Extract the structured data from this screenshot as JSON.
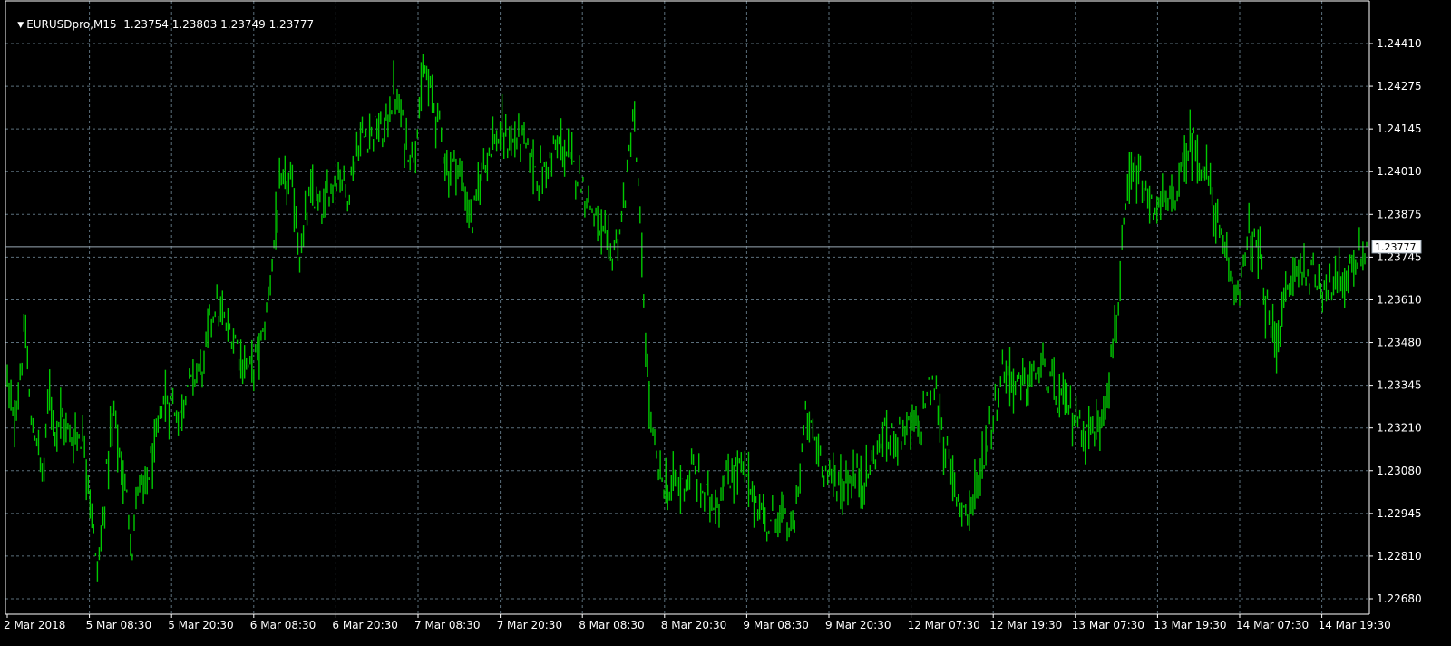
{
  "chart_header": {
    "menu_arrow": "▼",
    "symbol": "EURUSDpro,M15",
    "ohlc": "1.23754 1.23803 1.23749 1.23777"
  },
  "current_price": "1.23777",
  "colors": {
    "background": "#000000",
    "grid": "#5b6f7c",
    "bars": "#00c800",
    "axis": "#ffffff",
    "price_line": "#9aa9b5"
  },
  "chart_data": {
    "type": "line",
    "instrument": "EURUSDpro",
    "timeframe": "M15",
    "grid": true,
    "y_ticks": [
      "1.24410",
      "1.24275",
      "1.24145",
      "1.24010",
      "1.23875",
      "1.23745",
      "1.23610",
      "1.23480",
      "1.23345",
      "1.23210",
      "1.23080",
      "1.22945",
      "1.22810",
      "1.22680"
    ],
    "x_ticks": [
      "2 Mar 2018",
      "5 Mar 08:30",
      "5 Mar 20:30",
      "6 Mar 08:30",
      "6 Mar 20:30",
      "7 Mar 08:30",
      "7 Mar 20:30",
      "8 Mar 08:30",
      "8 Mar 20:30",
      "9 Mar 08:30",
      "9 Mar 20:30",
      "12 Mar 07:30",
      "12 Mar 19:30",
      "13 Mar 07:30",
      "13 Mar 19:30",
      "14 Mar 07:30",
      "14 Mar 19:30"
    ],
    "ylim": [
      1.2268,
      1.2441
    ],
    "last_price": 1.23777,
    "series": [
      {
        "values": [
          1.2337,
          1.2322,
          1.2335,
          1.2352,
          1.2322,
          1.2318,
          1.2305,
          1.2334,
          1.2322,
          1.2325,
          1.232,
          1.2318,
          1.232,
          1.2316,
          1.23,
          1.2275,
          1.229,
          1.2315,
          1.2326,
          1.231,
          1.23,
          1.2284,
          1.2305,
          1.23,
          1.231,
          1.2315,
          1.233,
          1.233,
          1.2328,
          1.2325,
          1.2335,
          1.2335,
          1.234,
          1.234,
          1.2355,
          1.236,
          1.2355,
          1.2352,
          1.235,
          1.2345,
          1.234,
          1.234,
          1.2345,
          1.235,
          1.2365,
          1.2385,
          1.2395,
          1.2398,
          1.2395,
          1.2375,
          1.2385,
          1.2395,
          1.239,
          1.2388,
          1.2395,
          1.24,
          1.24,
          1.2395,
          1.2402,
          1.241,
          1.2412,
          1.2413,
          1.2415,
          1.2412,
          1.242,
          1.2425,
          1.2418,
          1.241,
          1.2405,
          1.242,
          1.2432,
          1.2425,
          1.242,
          1.241,
          1.24,
          1.2405,
          1.24,
          1.2392,
          1.2385,
          1.2395,
          1.2405,
          1.241,
          1.241,
          1.2412,
          1.241,
          1.241,
          1.2412,
          1.2408,
          1.2405,
          1.24,
          1.24,
          1.2405,
          1.2408,
          1.241,
          1.2405,
          1.2402,
          1.24,
          1.2395,
          1.239,
          1.2385,
          1.238,
          1.2375,
          1.2378,
          1.2385,
          1.24,
          1.242,
          1.239,
          1.235,
          1.232,
          1.231,
          1.2305,
          1.23,
          1.2305,
          1.2303,
          1.2305,
          1.2308,
          1.2305,
          1.23,
          1.23,
          1.2298,
          1.2303,
          1.2305,
          1.2308,
          1.231,
          1.2305,
          1.23,
          1.2298,
          1.2292,
          1.229,
          1.2295,
          1.2293,
          1.229,
          1.229,
          1.231,
          1.2325,
          1.232,
          1.2315,
          1.231,
          1.2305,
          1.2305,
          1.2303,
          1.2305,
          1.2306,
          1.2306,
          1.2305,
          1.231,
          1.2315,
          1.2318,
          1.2318,
          1.232,
          1.232,
          1.2322,
          1.2322,
          1.232,
          1.233,
          1.2335,
          1.233,
          1.2318,
          1.231,
          1.2302,
          1.2298,
          1.2295,
          1.23,
          1.2305,
          1.2315,
          1.2322,
          1.233,
          1.234,
          1.2338,
          1.2335,
          1.2335,
          1.2335,
          1.2337,
          1.234,
          1.2338,
          1.2335,
          1.233,
          1.233,
          1.2328,
          1.2325,
          1.2322,
          1.232,
          1.232,
          1.2322,
          1.233,
          1.234,
          1.2355,
          1.2375,
          1.2395,
          1.24,
          1.2398,
          1.2392,
          1.239,
          1.239,
          1.2392,
          1.239,
          1.2395,
          1.24,
          1.2408,
          1.241,
          1.2405,
          1.24,
          1.2395,
          1.2385,
          1.2375,
          1.2368,
          1.2365,
          1.2368,
          1.2378,
          1.238,
          1.2375,
          1.236,
          1.2352,
          1.235,
          1.2358,
          1.2365,
          1.237,
          1.2372,
          1.237,
          1.2368,
          1.2368,
          1.2366,
          1.2366,
          1.2366,
          1.2368,
          1.237,
          1.2372,
          1.2375,
          1.2377
        ]
      }
    ]
  }
}
